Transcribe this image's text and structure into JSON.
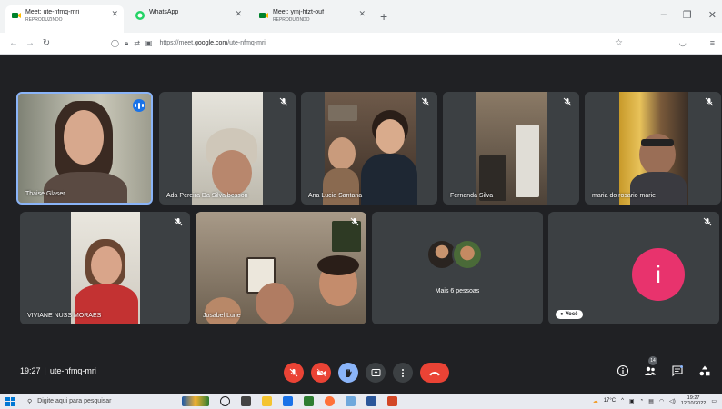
{
  "browser": {
    "tabs": [
      {
        "title": "Meet: ute-nfmq-mri",
        "subtitle": "REPRODUZINDO",
        "active": true
      },
      {
        "title": "WhatsApp",
        "subtitle": "",
        "active": false
      },
      {
        "title": "Meet: ymj-htzt-ouf",
        "subtitle": "REPRODUZINDO",
        "active": false
      }
    ],
    "new_tab": "+",
    "url_prefix": "https://meet.",
    "url_domain": "google.com",
    "url_path": "/ute-nfmq-mri"
  },
  "participants": [
    {
      "name": "Thaise Glaser",
      "speaking": true,
      "muted": false
    },
    {
      "name": "Ada Pereira Da Silva besson",
      "muted": true
    },
    {
      "name": "Ana Lucia Santana",
      "muted": true
    },
    {
      "name": "Fernanda Silva",
      "muted": true
    },
    {
      "name": "maria do rosario marie",
      "muted": true
    },
    {
      "name": "VIVIANE NUSS MORAES",
      "muted": true
    },
    {
      "name": "Josabel Lune",
      "muted": true
    }
  ],
  "more_people": {
    "label": "Mais 6 pessoas"
  },
  "self_tile": {
    "initial": "i",
    "badge": "Você",
    "avatar_color": "#e8336d"
  },
  "meeting": {
    "time": "19:27",
    "separator": "|",
    "code": "ute-nfmq-mri",
    "participant_count": "14"
  },
  "colors": {
    "end_call": "#ea4335",
    "accent": "#8ab4f8",
    "bg": "#202124",
    "tile": "#3c4043"
  },
  "taskbar": {
    "search_placeholder": "Digite aqui para pesquisar",
    "weather": "17°C",
    "clock_time": "19:27",
    "clock_date": "12/10/2022"
  }
}
